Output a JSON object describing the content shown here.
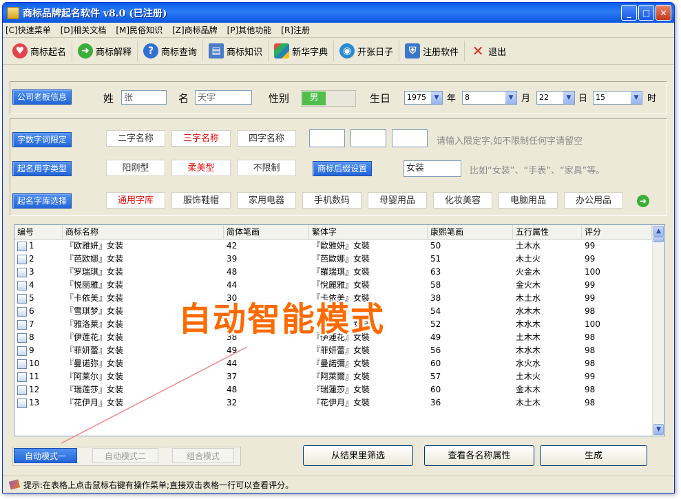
{
  "window": {
    "title": "商标品牌起名软件 v8.0 (已注册)"
  },
  "menu": [
    "[C]快速菜单",
    "[D]相关文档",
    "[M]民俗知识",
    "[Z]商标品牌",
    "[P]其他功能",
    "[R]注册"
  ],
  "toolbar": [
    {
      "label": "商标起名",
      "icon": "heart-icon",
      "color": "#e2454f"
    },
    {
      "label": "商标解释",
      "icon": "arrow-right-icon",
      "color": "#3cae3a"
    },
    {
      "label": "商标查询",
      "icon": "help-icon",
      "color": "#2f6fd6"
    },
    {
      "label": "商标知识",
      "icon": "document-icon",
      "color": "#4a7cc7"
    },
    {
      "label": "新华字典",
      "icon": "windows-logo-icon",
      "color": "#e67e22"
    },
    {
      "label": "开张日子",
      "icon": "globe-icon",
      "color": "#2b8ad0"
    },
    {
      "label": "注册软件",
      "icon": "shield-icon",
      "color": "#3b78c9"
    },
    {
      "label": "退出",
      "icon": "close-x-icon",
      "color": "#d9261c"
    }
  ],
  "owner": {
    "tag": "公司老板信息",
    "surname_label": "姓",
    "surname": "张",
    "name_label": "名",
    "name": "天宇",
    "gender_label": "性别",
    "gender": "男",
    "birth_label": "生日",
    "year": "1975",
    "year_unit": "年",
    "month": "8",
    "month_unit": "月",
    "day": "22",
    "day_unit": "日",
    "hour": "15",
    "hour_unit": "时"
  },
  "limits": {
    "tag": "字数字词限定",
    "options": [
      "二字名称",
      "三字名称",
      "四字名称"
    ],
    "hint": "请输入限定字,如不限制任何字请留空"
  },
  "types": {
    "tag": "起名用字类型",
    "options": [
      "阳刚型",
      "柔美型",
      "不限制"
    ],
    "suffix_tag": "商标后缀设置",
    "suffix_value": "女装",
    "suffix_hint": "比如“女装”、“手表”、“家具”等。"
  },
  "library": {
    "tag": "起名字库选择",
    "options": [
      "通用字库",
      "服饰鞋帽",
      "家用电器",
      "手机数码",
      "母婴用品",
      "化妆美容",
      "电脑用品",
      "办公用品"
    ]
  },
  "table": {
    "headers": [
      "编号",
      "商标名称",
      "简体笔画",
      "繁体字",
      "康熙笔画",
      "五行属性",
      "评分"
    ],
    "rows": [
      [
        "1",
        "『欧雅妍』女装",
        "42",
        "『歐雅妍』女裝",
        "50",
        "土木水",
        "99"
      ],
      [
        "2",
        "『芭欧娜』女装",
        "39",
        "『芭歐娜』女裝",
        "51",
        "木土火",
        "99"
      ],
      [
        "3",
        "『罗瑞琪』女装",
        "48",
        "『羅瑞琪』女裝",
        "63",
        "火金木",
        "100"
      ],
      [
        "4",
        "『悦丽雅』女装",
        "44",
        "『悅麗雅』女裝",
        "58",
        "金火木",
        "99"
      ],
      [
        "5",
        "『卡依美』女装",
        "30",
        "『卡依美』女裝",
        "38",
        "木土水",
        "99"
      ],
      [
        "6",
        "『雪琪梦』女装",
        "44",
        "『雪琪夢』女裝",
        "54",
        "水木木",
        "98"
      ],
      [
        "7",
        "『雅洛莱』女装",
        "46",
        "『雅洛萊』女裝",
        "52",
        "木水木",
        "100"
      ],
      [
        "8",
        "『伊莲花』女装",
        "38",
        "『伊蓮花』女裝",
        "49",
        "土木木",
        "98"
      ],
      [
        "9",
        "『菲妍蕾』女装",
        "49",
        "『菲妍蕾』女裝",
        "56",
        "木水木",
        "98"
      ],
      [
        "10",
        "『曼诺弥』女装",
        "44",
        "『曼諾彌』女裝",
        "60",
        "水火水",
        "98"
      ],
      [
        "11",
        "『阿莱尔』女装",
        "37",
        "『阿萊爾』女裝",
        "57",
        "土木火",
        "99"
      ],
      [
        "12",
        "『瑞莲莎』女装",
        "48",
        "『瑞蓮莎』女裝",
        "60",
        "金木木",
        "98"
      ],
      [
        "13",
        "『花伊月』女装",
        "32",
        "『花伊月』女裝",
        "36",
        "木土木",
        "98"
      ]
    ]
  },
  "overlay_text": "自动智能模式",
  "modes": [
    "自动模式一",
    "自动模式二",
    "组合模式"
  ],
  "actions": [
    "从结果里筛选",
    "查看各名称属性",
    "生成"
  ],
  "status": "提示:在表格上点击鼠标右键有操作菜单;直接双击表格一行可以查看评分。"
}
